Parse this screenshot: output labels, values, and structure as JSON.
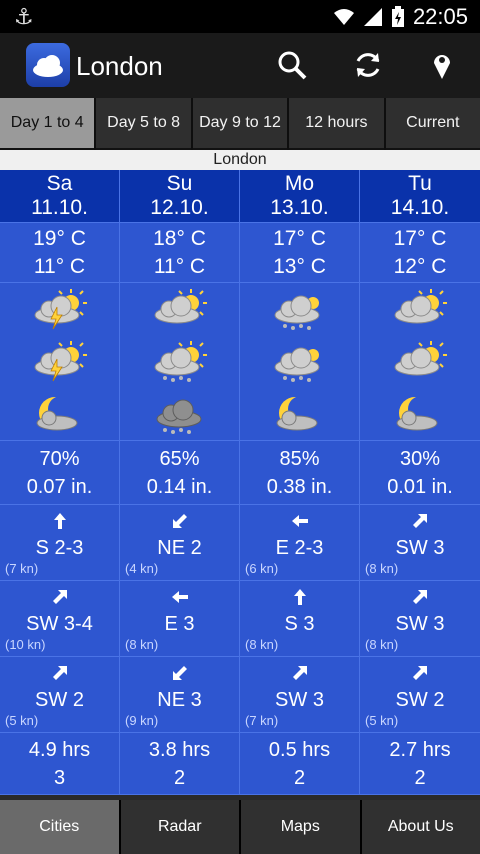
{
  "status": {
    "time": "22:05"
  },
  "header": {
    "title": "London"
  },
  "tabs": [
    "Day 1 to 4",
    "Day 5 to 8",
    "Day 9 to 12",
    "12 hours",
    "Current"
  ],
  "city_band": "London",
  "days": [
    {
      "name": "Sa",
      "date": "11.10.",
      "high": "19° C",
      "low": "11° C",
      "icons": [
        "storm-sun-icon",
        "storm-sun-icon",
        "moon-cloud-icon"
      ],
      "rain_chance": "70%",
      "rain_amount": "0.07 in.",
      "winds": [
        {
          "arrow": "up",
          "dir": "S 2-3",
          "kn": "(7 kn)"
        },
        {
          "arrow": "up-right",
          "dir": "SW 3-4",
          "kn": "(10 kn)"
        },
        {
          "arrow": "up-right",
          "dir": "SW 2",
          "kn": "(5 kn)"
        }
      ],
      "sun_hours": "4.9 hrs",
      "index": "3"
    },
    {
      "name": "Su",
      "date": "12.10.",
      "high": "18° C",
      "low": "11° C",
      "icons": [
        "sun-cloud-icon",
        "rain-sun-icon",
        "rain-cloud-icon"
      ],
      "rain_chance": "65%",
      "rain_amount": "0.14 in.",
      "winds": [
        {
          "arrow": "down-left",
          "dir": "NE 2",
          "kn": "(4 kn)"
        },
        {
          "arrow": "left",
          "dir": "E 3",
          "kn": "(8 kn)"
        },
        {
          "arrow": "down-left",
          "dir": "NE 3",
          "kn": "(9 kn)"
        }
      ],
      "sun_hours": "3.8 hrs",
      "index": "2"
    },
    {
      "name": "Mo",
      "date": "13.10.",
      "high": "17° C",
      "low": "13° C",
      "icons": [
        "rain-cloud-sun-icon",
        "rain-cloud-sun-icon",
        "moon-cloud-icon"
      ],
      "rain_chance": "85%",
      "rain_amount": "0.38 in.",
      "winds": [
        {
          "arrow": "left",
          "dir": "E 2-3",
          "kn": "(6 kn)"
        },
        {
          "arrow": "up",
          "dir": "S 3",
          "kn": "(8 kn)"
        },
        {
          "arrow": "up-right",
          "dir": "SW 3",
          "kn": "(7 kn)"
        }
      ],
      "sun_hours": "0.5 hrs",
      "index": "2"
    },
    {
      "name": "Tu",
      "date": "14.10.",
      "high": "17° C",
      "low": "12° C",
      "icons": [
        "sun-cloud-icon",
        "sun-cloud-icon",
        "moon-cloud-icon"
      ],
      "rain_chance": "30%",
      "rain_amount": "0.01 in.",
      "winds": [
        {
          "arrow": "up-right",
          "dir": "SW 3",
          "kn": "(8 kn)"
        },
        {
          "arrow": "up-right",
          "dir": "SW 3",
          "kn": "(8 kn)"
        },
        {
          "arrow": "up-right",
          "dir": "SW 2",
          "kn": "(5 kn)"
        }
      ],
      "sun_hours": "2.7 hrs",
      "index": "2"
    }
  ],
  "bottom_nav": [
    "Cities",
    "Radar",
    "Maps",
    "About Us"
  ]
}
